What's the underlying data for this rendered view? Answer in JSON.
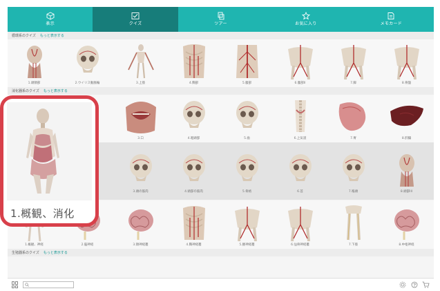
{
  "nav": {
    "items": [
      {
        "label": "表示",
        "icon": "cube-icon",
        "active": false
      },
      {
        "label": "クイズ",
        "icon": "quiz-icon",
        "active": true
      },
      {
        "label": "ツアー",
        "icon": "tour-icon",
        "active": false
      },
      {
        "label": "お気に入り",
        "icon": "star-icon",
        "active": false
      },
      {
        "label": "メモカード",
        "icon": "memo-card-icon",
        "active": false
      }
    ]
  },
  "sections": [
    {
      "title": "循環系のクイズ",
      "more": "もっと表示する",
      "items": [
        {
          "label": "1.頭頸部",
          "kind": "head"
        },
        {
          "label": "2.ウイリス動脈輪",
          "kind": "skull"
        },
        {
          "label": "3.上肢",
          "kind": "arm"
        },
        {
          "label": "4.胸部",
          "kind": "chest"
        },
        {
          "label": "5.腹部",
          "kind": "torso"
        },
        {
          "label": "6.腹部II",
          "kind": "pelvis"
        },
        {
          "label": "7.脚",
          "kind": "pelvis"
        },
        {
          "label": "8.骨盤",
          "kind": "pelvis"
        }
      ]
    },
    {
      "title": "消化器系のクイズ",
      "more": "もっと表示する",
      "items": [
        {
          "label": "1.概観、消化",
          "kind": "body"
        },
        {
          "label": "2.頭部",
          "kind": "skull"
        },
        {
          "label": "3.口",
          "kind": "mouth"
        },
        {
          "label": "4.咽頭部",
          "kind": "skull"
        },
        {
          "label": "5.歯",
          "kind": "skull"
        },
        {
          "label": "6.上気道",
          "kind": "spine"
        },
        {
          "label": "7.胃",
          "kind": "stomach"
        },
        {
          "label": "8.肝臓",
          "kind": "liver"
        }
      ]
    },
    {
      "title": "",
      "more": "",
      "items": [
        {
          "label": "1.顔面",
          "kind": "skull"
        },
        {
          "label": "2.頭蓋",
          "kind": "skull"
        },
        {
          "label": "3.頭の筋肉",
          "kind": "skull"
        },
        {
          "label": "4.頭部の筋肉",
          "kind": "skull"
        },
        {
          "label": "5.骨格",
          "kind": "skull"
        },
        {
          "label": "6.首",
          "kind": "skull"
        },
        {
          "label": "7.喉頭",
          "kind": "skull"
        },
        {
          "label": "8.頭部III",
          "kind": "head"
        }
      ]
    },
    {
      "title": "",
      "more": "",
      "items": [
        {
          "label": "1.概観、神経",
          "kind": "body"
        },
        {
          "label": "2.脳神経",
          "kind": "brain"
        },
        {
          "label": "3.頸神経叢",
          "kind": "brain"
        },
        {
          "label": "4.胸神経叢",
          "kind": "chest"
        },
        {
          "label": "5.腰神経叢",
          "kind": "pelvis"
        },
        {
          "label": "6.仙骨神経叢",
          "kind": "pelvis"
        },
        {
          "label": "7.下肢",
          "kind": "legs"
        },
        {
          "label": "8.中枢神経",
          "kind": "brain"
        }
      ]
    },
    {
      "title": "生殖器系のクイズ",
      "more": "もっと表示する",
      "items": []
    }
  ],
  "highlight": {
    "label": "1.概観、消化"
  },
  "search": {
    "placeholder": "",
    "icon": "search-icon"
  },
  "bottom_icons": [
    "grid-view-icon",
    "settings-icon",
    "help-icon",
    "cart-icon"
  ],
  "colors": {
    "nav": "#1fb5b0",
    "nav_active": "#177d7a",
    "link": "#1a9a96",
    "highlight": "#d8404a"
  }
}
